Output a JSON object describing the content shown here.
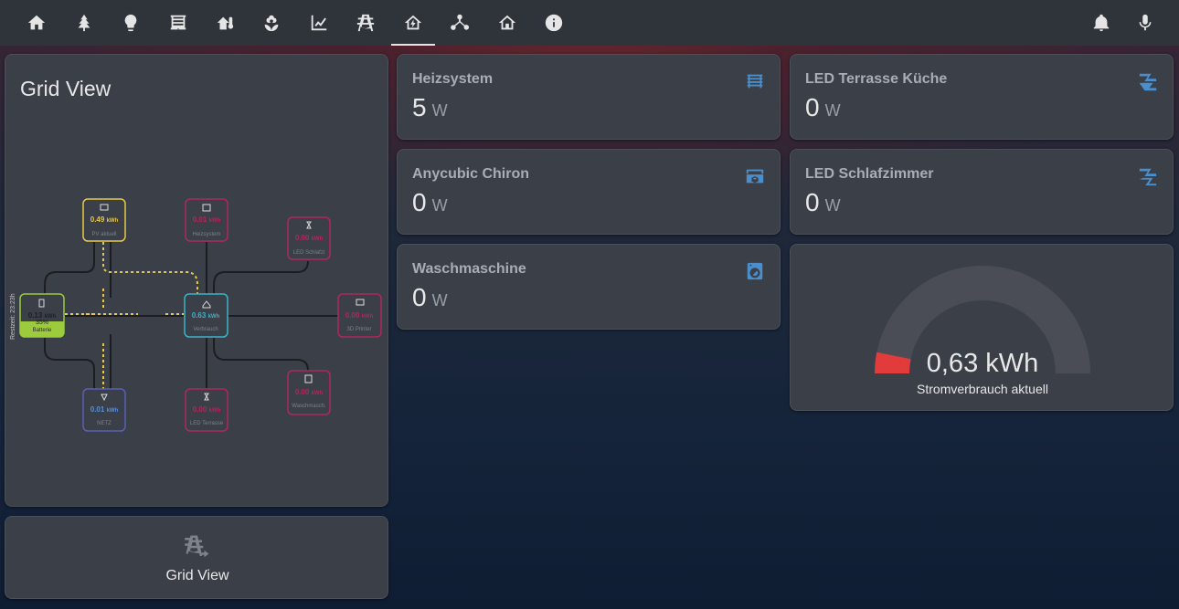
{
  "grid_card": {
    "title": "Grid View",
    "restzeit": "Restzeit: 23:23h",
    "nodes": {
      "pv": {
        "value": "0.49",
        "unit": "kWh",
        "label": "PV aktuell"
      },
      "heiz": {
        "value": "0.01",
        "unit": "kWh",
        "label": "Heizsystem"
      },
      "ledschlaf": {
        "value": "0.00",
        "unit": "kWh",
        "label": "LED Schlafzi"
      },
      "batterie": {
        "value": "0.13",
        "unit": "kWh",
        "percent": "35%",
        "label": "Batterie"
      },
      "verbrauch": {
        "value": "0.63",
        "unit": "kWh",
        "label": "Verbrauch"
      },
      "printer": {
        "value": "0.00",
        "unit": "kWh",
        "label": "3D Printer"
      },
      "netz": {
        "value": "0.01",
        "unit": "kWh",
        "label": "NETZ"
      },
      "ledterrasse": {
        "value": "0.00",
        "unit": "kWh",
        "label": "LED Terrasse"
      },
      "wasch": {
        "value": "0.00",
        "unit": "kWh",
        "label": "Waschmasch."
      }
    }
  },
  "button_card": {
    "label": "Grid View"
  },
  "entities": {
    "heizsystem": {
      "name": "Heizsystem",
      "value": "5",
      "unit": "W"
    },
    "anycubic": {
      "name": "Anycubic Chiron",
      "value": "0",
      "unit": "W"
    },
    "waschmaschine": {
      "name": "Waschmaschine",
      "value": "0",
      "unit": "W"
    },
    "led_kueche": {
      "name": "LED Terrasse Küche",
      "value": "0",
      "unit": "W"
    },
    "led_schlaf": {
      "name": "LED Schlafzimmer",
      "value": "0",
      "unit": "W"
    }
  },
  "gauge": {
    "value_text": "0,63 kWh",
    "label": "Stromverbrauch aktuell",
    "fraction": 0.063
  },
  "colors": {
    "accent_icon": "#4a8fcc",
    "pv": "#e8c84a",
    "battery": "#9ccc3d",
    "consumption": "#3cb3c9",
    "device": "#b0285a",
    "grid": "#5b5fb5",
    "gauge_fill": "#e23b3b"
  }
}
